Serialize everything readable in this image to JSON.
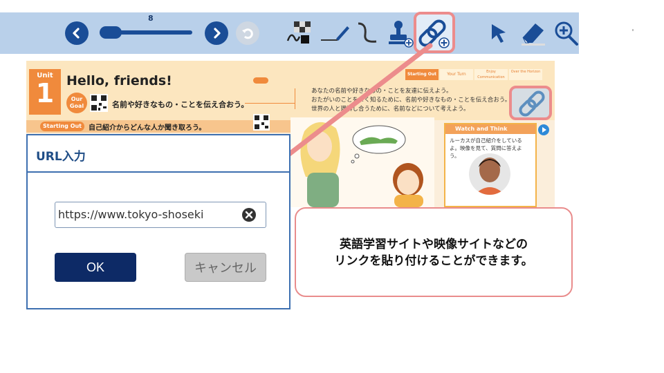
{
  "toolbar": {
    "page_number": "8",
    "icons": [
      "back-arrow-icon",
      "page-slider",
      "forward-arrow-icon",
      "undo-icon",
      "mask-tool-icon",
      "pen-icon",
      "line-icon",
      "stamp-icon",
      "link-add-icon",
      "pointer-icon",
      "eraser-icon",
      "zoom-in-icon"
    ]
  },
  "textbook": {
    "unit_label": "Unit",
    "unit_number": "1",
    "unit_title": "Hello, friends!",
    "our_goal_label": "Our Goal",
    "goal_text": "名前や好きなもの・ことを伝え合おう。",
    "bullets": [
      "あなたの名前や好きなもの・ことを友達に伝えよう。",
      "おたがいのことをよく知るために、名前や好きなもの・ことを伝え合おう。",
      "世界の人と理解し合うために、名前などについて考えよう。"
    ],
    "tabs": [
      "Starting Out",
      "Your Turn",
      "Enjoy Communication",
      "Over the Horizon"
    ],
    "starting_out_label": "Starting Out",
    "starting_out_text": "自己紹介からどんな人か聞き取ろう。",
    "watch_title": "Watch and Think",
    "watch_text": "ルーカスが自己紹介をしているよ。映像を見て、質問に答えよう。"
  },
  "dialog": {
    "title": "URL入力",
    "url_value": "https://www.tokyo-shoseki",
    "ok_label": "OK",
    "cancel_label": "キャンセル"
  },
  "callout": {
    "line1": "英語学習サイトや映像サイトなどの",
    "line2": "リンクを貼り付けることができます。"
  },
  "colors": {
    "toolbar_bg": "#b9d0ea",
    "nav_blue": "#1a4d97",
    "highlight_pink": "#ec8c8c",
    "ok_navy": "#0d2a66",
    "dialog_border": "#3d6fb0"
  }
}
